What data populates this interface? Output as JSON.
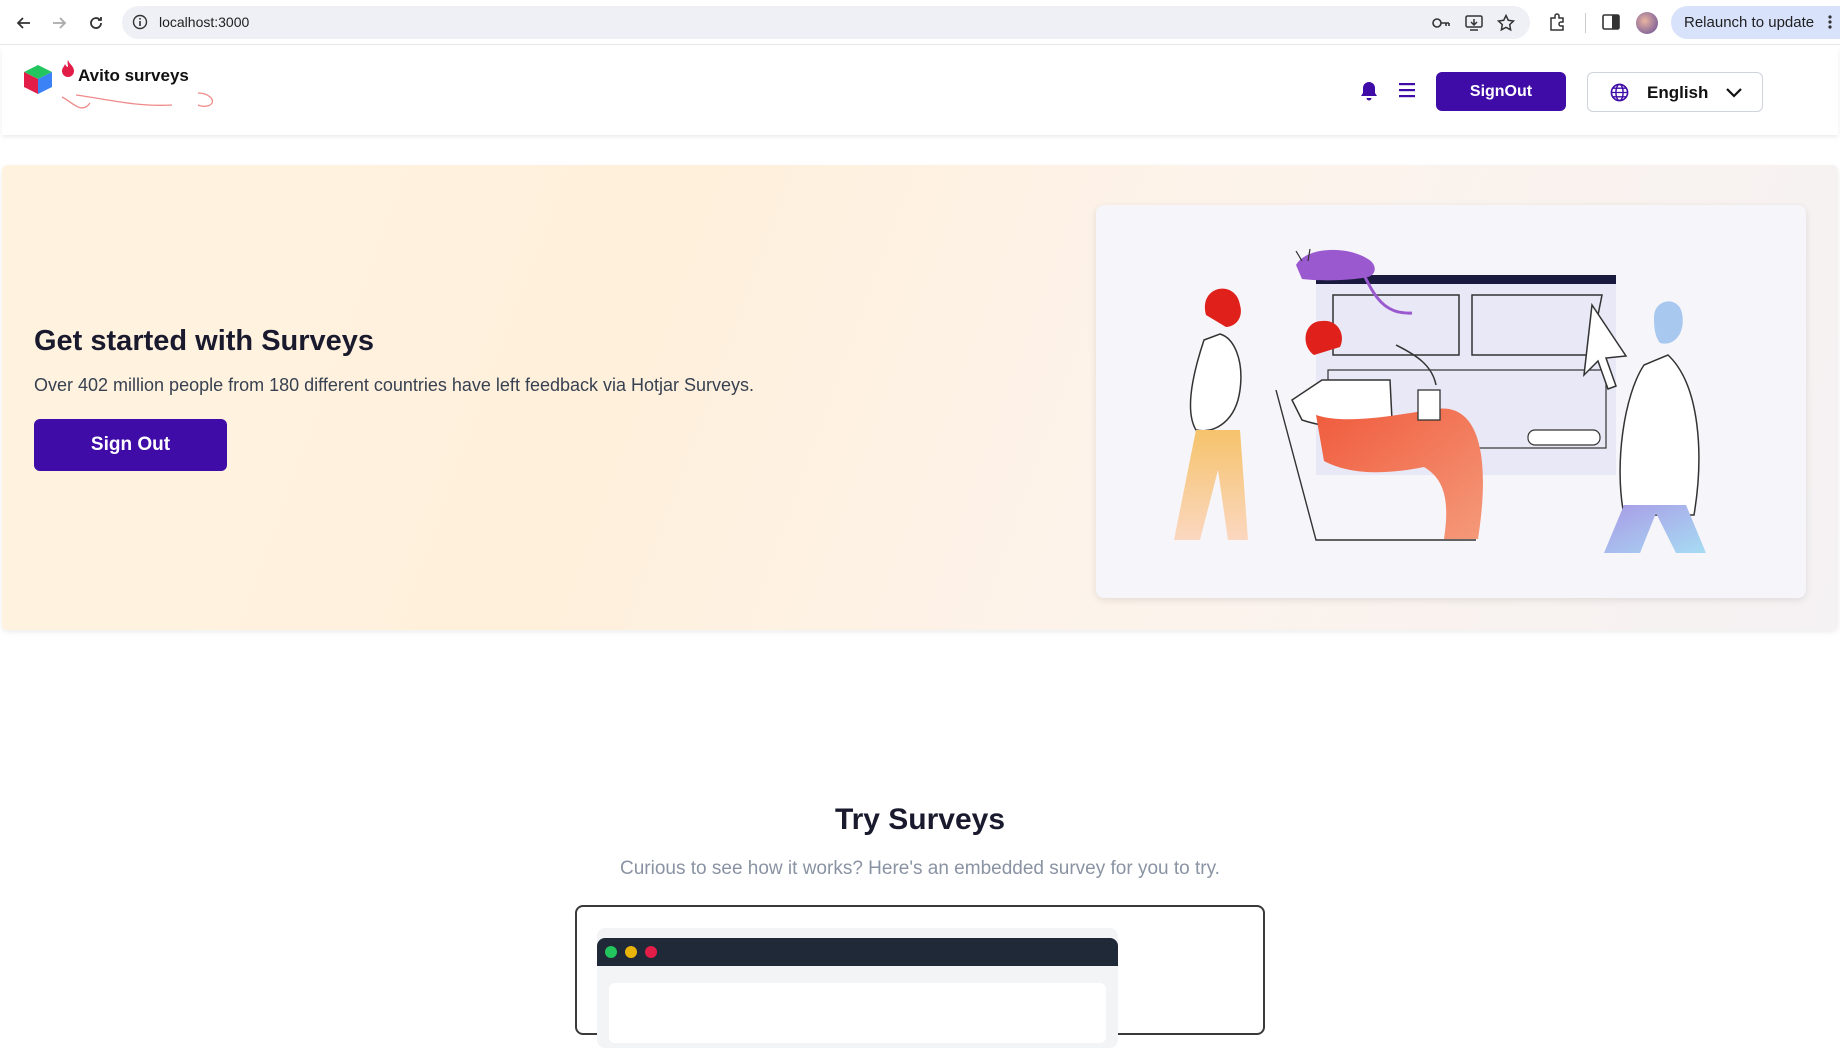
{
  "browser": {
    "url": "localhost:3000",
    "relaunch_label": "Relaunch to update",
    "icons": [
      "back-icon",
      "forward-icon",
      "reload-icon",
      "site-info-icon",
      "password-key-icon",
      "install-app-icon",
      "bookmark-star-icon",
      "extensions-icon",
      "side-panel-icon",
      "profile-avatar",
      "menu-kebab-icon"
    ]
  },
  "header": {
    "brand": "Avito surveys",
    "signout_label": "SignOut",
    "language": "English",
    "icons": [
      "cube-logo-icon",
      "flame-icon",
      "bell-icon",
      "hamburger-menu-icon",
      "globe-icon",
      "chevron-down-icon"
    ]
  },
  "hero": {
    "title": "Get started with Surveys",
    "subtitle": "Over 402 million people from 180 different countries have left feedback via Hotjar Surveys.",
    "button_label": "Sign Out"
  },
  "try": {
    "title": "Try Surveys",
    "subtitle": "Curious to see how it works? Here's an embedded survey for you to try."
  },
  "colors": {
    "primary": "#3f0ca8",
    "dot_green": "#22c55e",
    "dot_yellow": "#eab308",
    "dot_red": "#e11d48"
  }
}
